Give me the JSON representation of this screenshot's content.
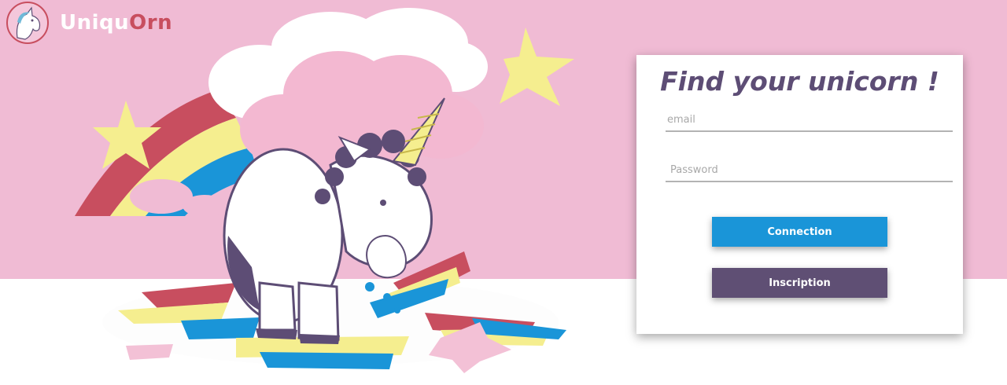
{
  "brand": {
    "name_part1": "Uniqu",
    "name_part2": "Orn",
    "logo_icon": "unicorn-head-icon",
    "colors": {
      "pink": "#f0bbd4",
      "red": "#c84e5f",
      "purple": "#5d4d75",
      "blue": "#1a95d8"
    }
  },
  "login": {
    "title": "Find your unicorn !",
    "email_placeholder": "email",
    "password_placeholder": "Password",
    "connect_label": "Connection",
    "signup_label": "Inscription"
  }
}
